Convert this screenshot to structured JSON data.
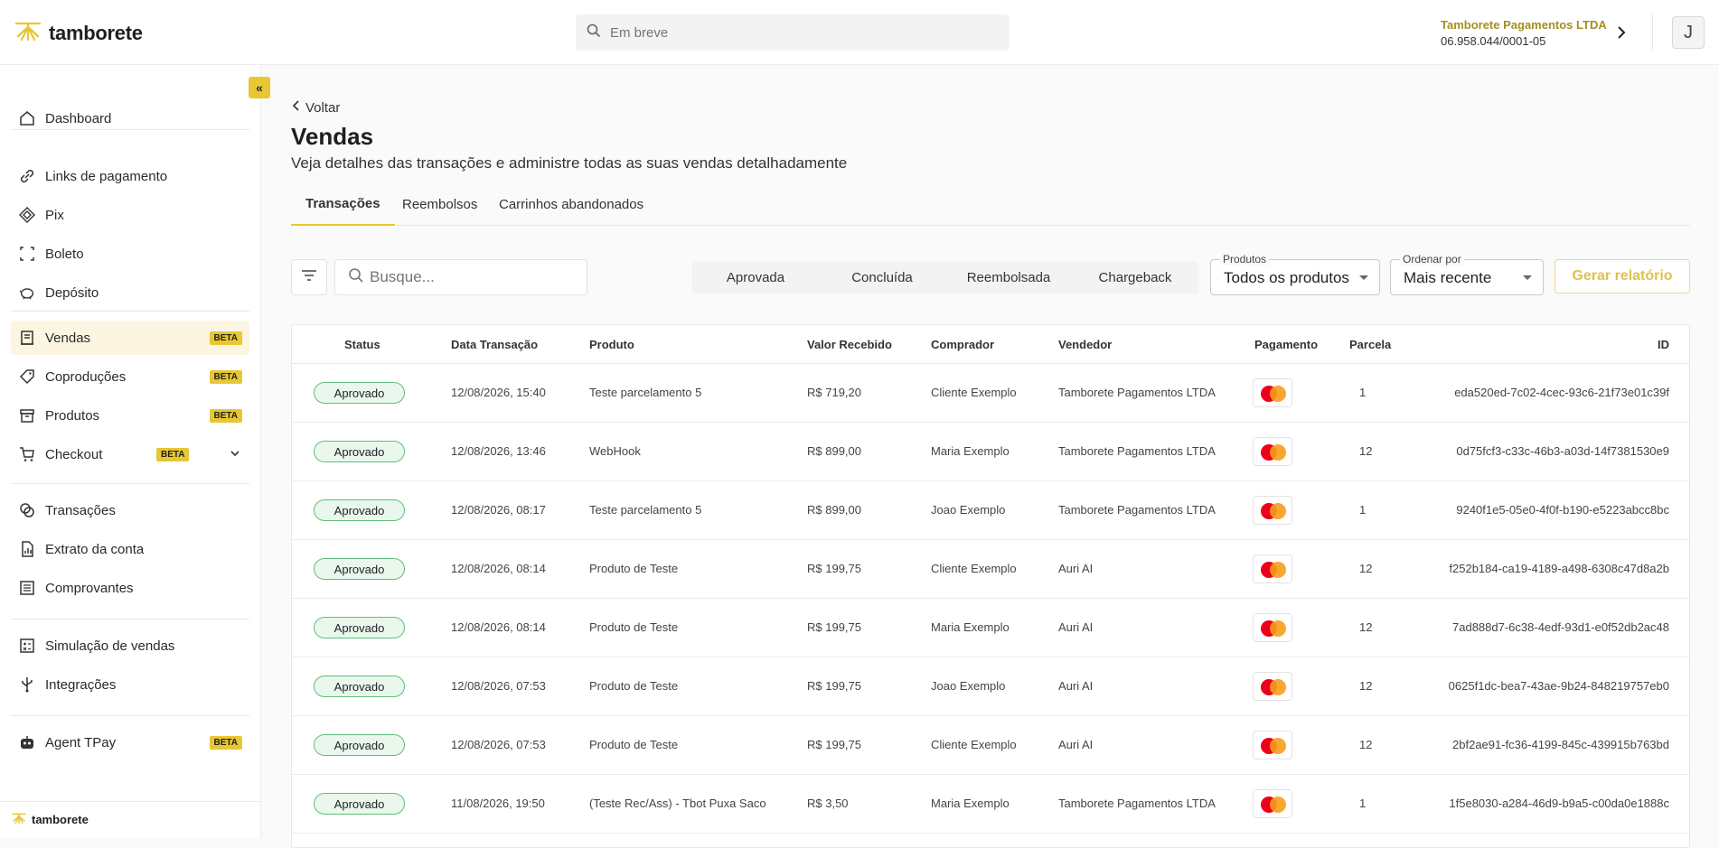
{
  "brand": {
    "name": "tamborete",
    "accent": "#e7c733"
  },
  "topbar": {
    "search_placeholder": "Em breve",
    "company_name": "Tamborete Pagamentos LTDA",
    "company_doc": "06.958.044/0001-05",
    "avatar_initial": "J"
  },
  "sidebar": {
    "collapse_label": "«",
    "items": [
      {
        "label": "Dashboard",
        "icon": "home-icon"
      },
      {
        "label": "Links de pagamento",
        "icon": "link-icon"
      },
      {
        "label": "Pix",
        "icon": "pix-icon"
      },
      {
        "label": "Boleto",
        "icon": "barcode-icon"
      },
      {
        "label": "Depósito",
        "icon": "piggy-bank-icon"
      },
      {
        "label": "Vendas",
        "icon": "receipt-icon",
        "badge": "BETA"
      },
      {
        "label": "Coproduções",
        "icon": "tag-icon",
        "badge": "BETA"
      },
      {
        "label": "Produtos",
        "icon": "box-icon",
        "badge": "BETA"
      },
      {
        "label": "Checkout",
        "icon": "cart-icon",
        "badge": "BETA"
      },
      {
        "label": "Transações",
        "icon": "coins-icon"
      },
      {
        "label": "Extrato da conta",
        "icon": "statement-icon"
      },
      {
        "label": "Comprovantes",
        "icon": "list-icon"
      },
      {
        "label": "Simulação de vendas",
        "icon": "calculator-icon"
      },
      {
        "label": "Integrações",
        "icon": "usb-icon"
      },
      {
        "label": "Agent TPay",
        "icon": "robot-icon",
        "badge": "BETA"
      }
    ],
    "footer_brand": "tamborete"
  },
  "main": {
    "back_label": "Voltar",
    "title": "Vendas",
    "subtitle": "Veja detalhes das transações e administre todas as suas vendas detalhadamente",
    "tabs": [
      "Transações",
      "Reembolsos",
      "Carrinhos abandonados"
    ],
    "search_placeholder": "Busque...",
    "status_filters": [
      "Aprovada",
      "Concluída",
      "Reembolsada",
      "Chargeback"
    ],
    "products_select": {
      "label": "Produtos",
      "value": "Todos os produtos"
    },
    "order_select": {
      "label": "Ordenar por",
      "value": "Mais recente"
    },
    "report_button": "Gerar relatório"
  },
  "table": {
    "columns": [
      "Status",
      "Data Transação",
      "Produto",
      "Valor Recebido",
      "Comprador",
      "Vendedor",
      "Pagamento",
      "Parcela",
      "ID"
    ],
    "rows": [
      {
        "status": "Aprovado",
        "date": "12/08/2026, 15:40",
        "product": "Teste parcelamento 5",
        "value": "R$ 719,20",
        "buyer": "Cliente Exemplo",
        "seller": "Tamborete Pagamentos LTDA",
        "installments": "1",
        "id": "eda520ed-7c02-4cec-93c6-21f73e01c39f"
      },
      {
        "status": "Aprovado",
        "date": "12/08/2026, 13:46",
        "product": "WebHook",
        "value": "R$ 899,00",
        "buyer": "Maria Exemplo",
        "seller": "Tamborete Pagamentos LTDA",
        "installments": "12",
        "id": "0d75fcf3-c33c-46b3-a03d-14f7381530e9"
      },
      {
        "status": "Aprovado",
        "date": "12/08/2026, 08:17",
        "product": "Teste parcelamento 5",
        "value": "R$ 899,00",
        "buyer": "Joao Exemplo",
        "seller": "Tamborete Pagamentos LTDA",
        "installments": "1",
        "id": "9240f1e5-05e0-4f0f-b190-e5223abcc8bc"
      },
      {
        "status": "Aprovado",
        "date": "12/08/2026, 08:14",
        "product": "Produto de Teste",
        "value": "R$ 199,75",
        "buyer": "Cliente Exemplo",
        "seller": "Auri AI",
        "installments": "12",
        "id": "f252b184-ca19-4189-a498-6308c47d8a2b"
      },
      {
        "status": "Aprovado",
        "date": "12/08/2026, 08:14",
        "product": "Produto de Teste",
        "value": "R$ 199,75",
        "buyer": "Maria Exemplo",
        "seller": "Auri AI",
        "installments": "12",
        "id": "7ad888d7-6c38-4edf-93d1-e0f52db2ac48"
      },
      {
        "status": "Aprovado",
        "date": "12/08/2026, 07:53",
        "product": "Produto de Teste",
        "value": "R$ 199,75",
        "buyer": "Joao Exemplo",
        "seller": "Auri AI",
        "installments": "12",
        "id": "0625f1dc-bea7-43ae-9b24-848219757eb0"
      },
      {
        "status": "Aprovado",
        "date": "12/08/2026, 07:53",
        "product": "Produto de Teste",
        "value": "R$ 199,75",
        "buyer": "Cliente Exemplo",
        "seller": "Auri AI",
        "installments": "12",
        "id": "2bf2ae91-fc36-4199-845c-439915b763bd"
      },
      {
        "status": "Aprovado",
        "date": "11/08/2026, 19:50",
        "product": "(Teste Rec/Ass) - Tbot Puxa Saco",
        "value": "R$ 3,50",
        "buyer": "Maria Exemplo",
        "seller": "Tamborete Pagamentos LTDA",
        "installments": "1",
        "id": "1f5e8030-a284-46d9-b9a5-c00da0e1888c"
      }
    ]
  }
}
